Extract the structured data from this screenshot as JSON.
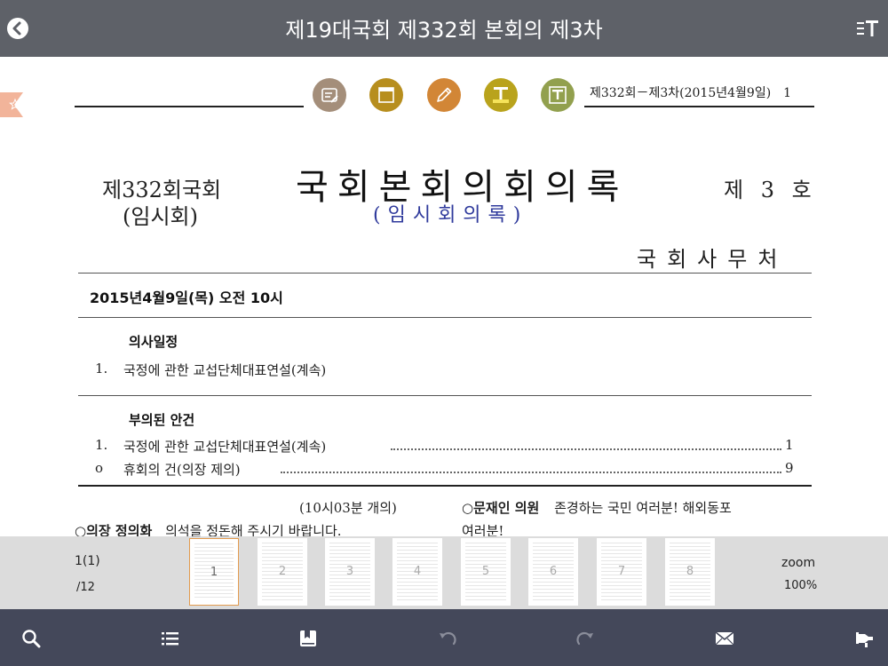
{
  "header": {
    "title": "제19대국회 제332회 본회의 제3차"
  },
  "page_ref": "제332회－제3차(2015년4월9일)　1",
  "document": {
    "session_line1": "제332회국회",
    "session_line2": "(임시회)",
    "main_title": "국회본회의회의록",
    "sub_title": "(임시회의록)",
    "issue_no": "제 3 호",
    "office": "국회사무처",
    "date_line": "2015년4월9일(목) 오전 10시",
    "agenda": {
      "heading": "의사일정",
      "items": [
        {
          "num": "1.",
          "text": "국정에 관한 교섭단체대표연설(계속)"
        }
      ]
    },
    "referred": {
      "heading": "부의된 안건",
      "items": [
        {
          "num": "1.",
          "text": "국정에 관한 교섭단체대표연설(계속)",
          "page": "1"
        },
        {
          "num": "o",
          "text": "휴회의 건(의장 제의)",
          "page": "9"
        }
      ]
    },
    "body": {
      "opening": "(10시03분 개의)",
      "speaker_left": "○의장 정의화",
      "text_left": "의석을 정돈해 주시기 바랍니다.",
      "speaker_right": "○문재인 의원",
      "text_right": "존경하는 국민 여러분! 해외동포",
      "text_right_2": "여러분!"
    }
  },
  "pager": {
    "current": "1(1)",
    "total": "/12",
    "thumbnails": [
      "1",
      "2",
      "3",
      "4",
      "5",
      "6",
      "7",
      "8"
    ],
    "zoom_label": "zoom",
    "zoom_value": "100%"
  },
  "colors": {
    "topbar": "#5e6168",
    "bottombar": "#44485a",
    "strip": "#dcdcdc",
    "tool_memo": "#a48e7a",
    "tool_window": "#b78e1e",
    "tool_pen": "#d28636",
    "tool_highlight": "#b9a31c",
    "tool_text": "#92a04e",
    "subtitle": "#2f3a9c",
    "active_thumb_border": "#e39b4f"
  },
  "icons": {
    "back": "chevron-left-circle-icon",
    "font": "text-size-icon",
    "bookmark": "star-tab-icon",
    "tools": [
      "memo-icon",
      "window-icon",
      "pen-icon",
      "highlight-text-icon",
      "text-box-icon"
    ],
    "bottom": [
      "search-icon",
      "list-icon",
      "bookmark-book-icon",
      "undo-icon",
      "redo-icon",
      "mail-icon",
      "thumb-tack-icon"
    ]
  }
}
